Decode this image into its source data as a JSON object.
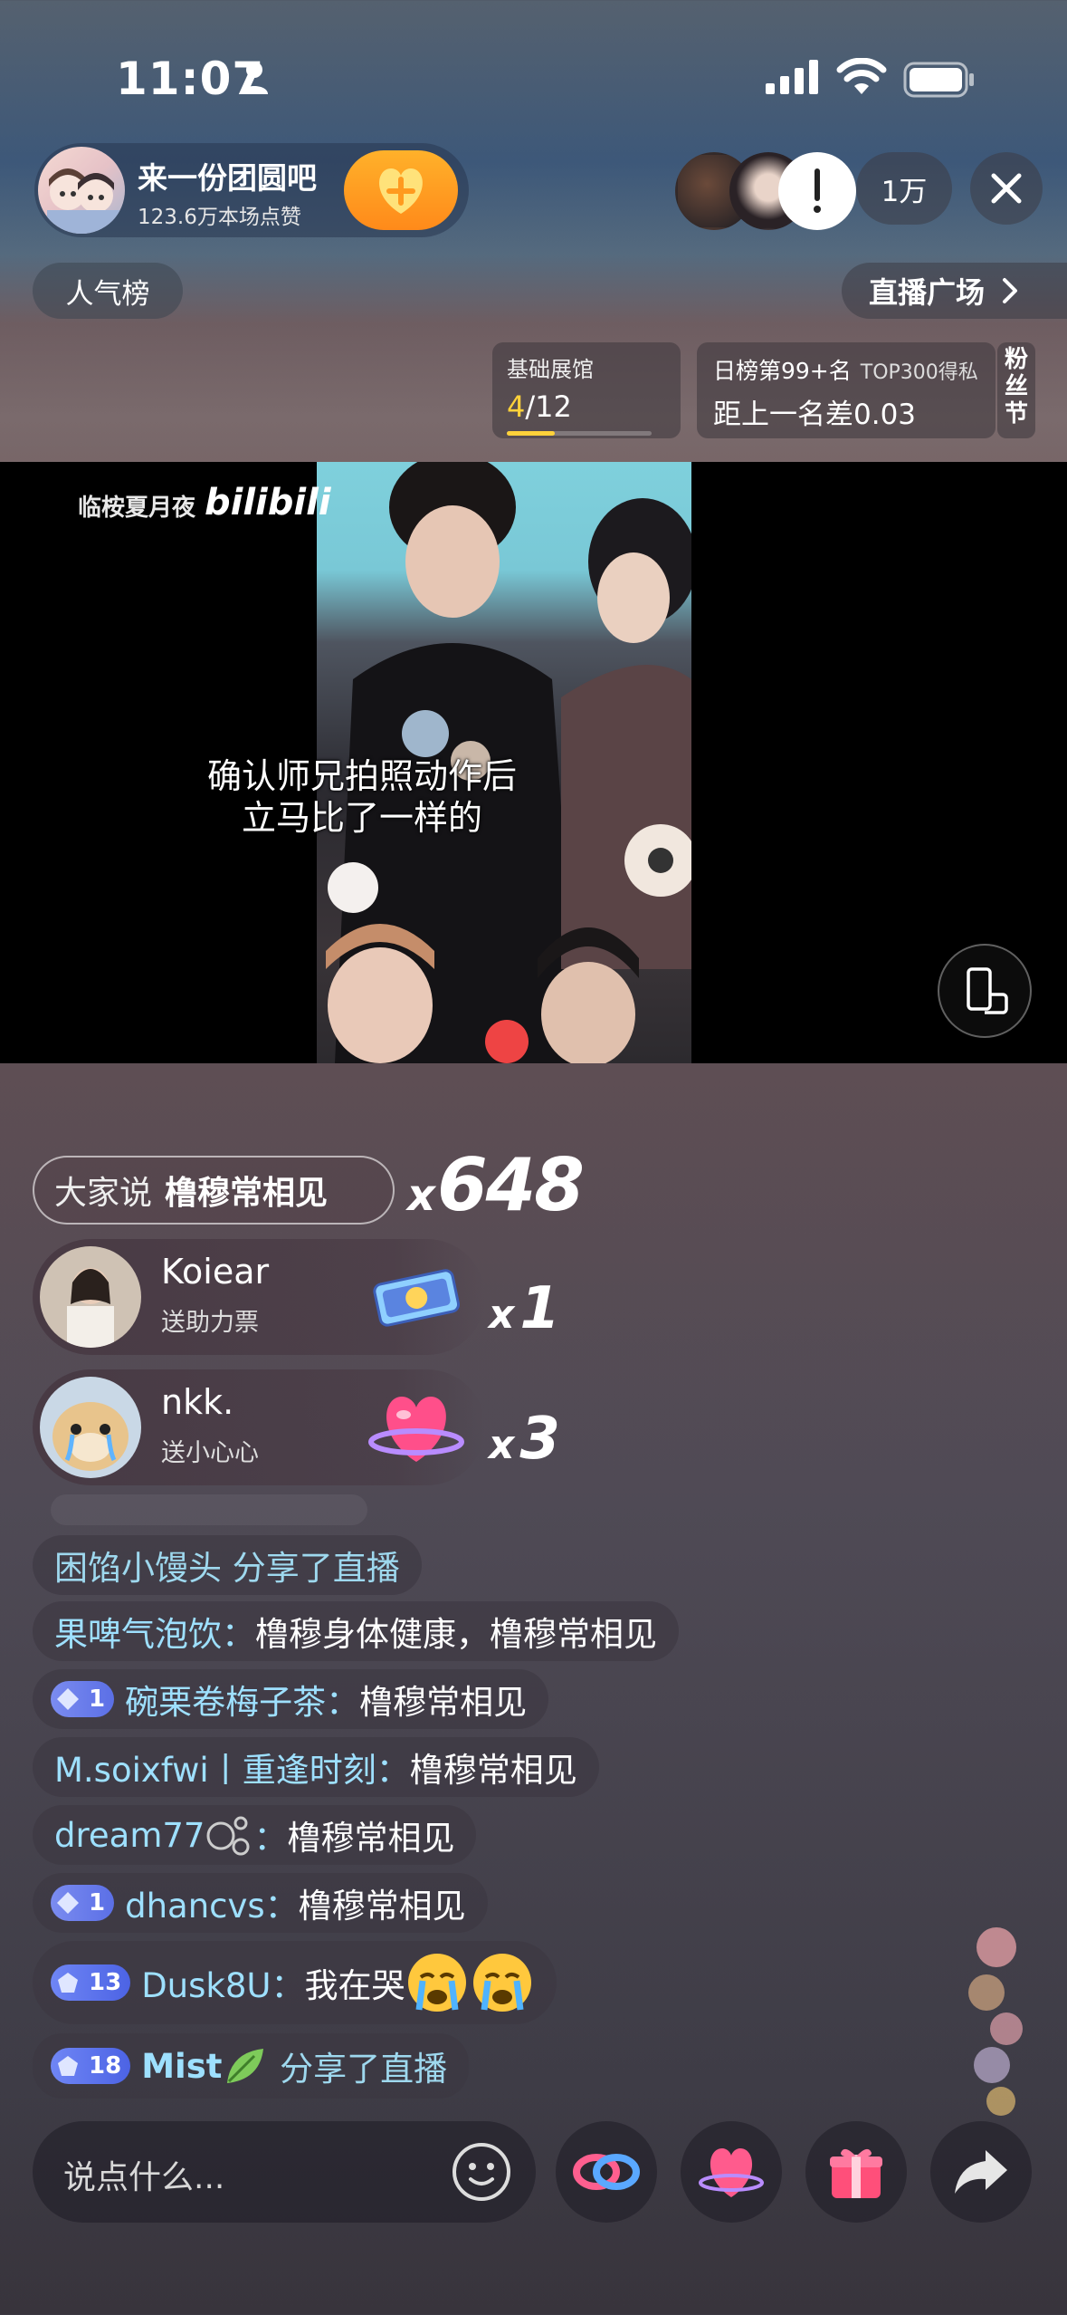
{
  "status_bar": {
    "time": "11:07"
  },
  "host": {
    "name": "来一份团圆吧",
    "likes": "123.6万本场点赞",
    "viewer_count": "1万"
  },
  "top_buttons": {
    "rank": "人气榜",
    "square": "直播广场"
  },
  "cards": {
    "hall_title": "基础展馆",
    "hall_current": "4",
    "hall_total": "/12",
    "hall_progress": 0.33,
    "rank_title": "日榜第99+名",
    "rank_sub": "TOP300得私",
    "rank_gap": "距上一名差0.03",
    "fan_festival": "粉丝节"
  },
  "video": {
    "watermark_text": "临桉夏月夜",
    "watermark_logo": "bilibili",
    "subtitle_line1": "确认师兄拍照动作后",
    "subtitle_line2": "立马比了一样的"
  },
  "combo": {
    "who": "大家说",
    "what": "橹穆常相见",
    "x": "x",
    "count": "648"
  },
  "gifts": [
    {
      "name": "Koiear",
      "action": "送助力票",
      "x": "x",
      "count": "1"
    },
    {
      "name": "nkk.",
      "action": "送小心心",
      "x": "x",
      "count": "3"
    }
  ],
  "chat": [
    {
      "user": "困馅小馒头",
      "text": "分享了直播"
    },
    {
      "user": "果啤气泡饮：",
      "text": "橹穆身体健康，橹穆常相见"
    },
    {
      "badge": "1",
      "user": "碗栗卷梅子茶：",
      "text": "橹穆常相见"
    },
    {
      "user": "M.soixfwi丨重逢时刻：",
      "text": "橹穆常相见"
    },
    {
      "user": "dream77",
      "user_tail": "：",
      "text": "橹穆常相见"
    },
    {
      "badge": "1",
      "user": "dhancvs：",
      "text": "橹穆常相见"
    },
    {
      "badge": "13",
      "user": "Dusk8U：",
      "text": "我在哭"
    },
    {
      "badge": "18",
      "user": "Mist",
      "text": "分享了直播"
    }
  ],
  "input": {
    "placeholder": "说点什么..."
  },
  "colors": {
    "accent_yellow": "#ffd23a",
    "username_blue": "#9ee0ff",
    "follow_orange": "#ff9a1f"
  }
}
